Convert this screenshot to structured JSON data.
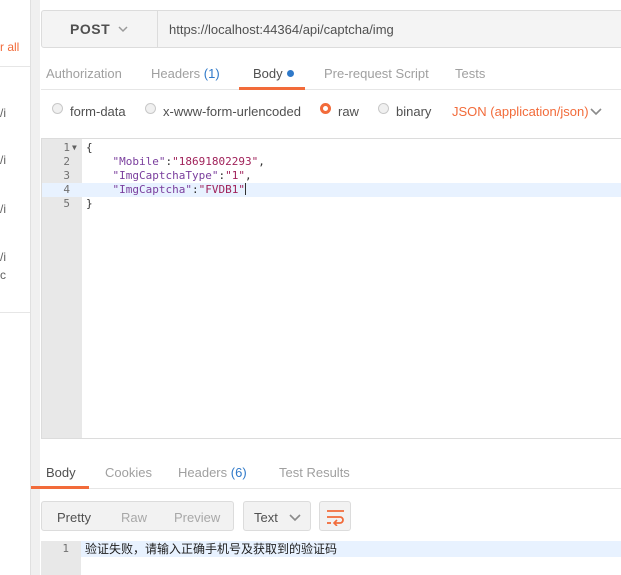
{
  "sidebar": {
    "clear_all": "r all",
    "fragments": [
      "/i",
      "/i",
      "/i",
      "/i",
      "c"
    ]
  },
  "request": {
    "method": "POST",
    "url": "https://localhost:44364/api/captcha/img"
  },
  "tabs": {
    "authorization": "Authorization",
    "headers": "Headers",
    "headers_count": "(1)",
    "body": "Body",
    "prerequest": "Pre-request Script",
    "tests": "Tests"
  },
  "body_types": {
    "form_data": "form-data",
    "urlencoded": "x-www-form-urlencoded",
    "raw": "raw",
    "binary": "binary",
    "selected": "raw",
    "content_type": "JSON (application/json)"
  },
  "editor": {
    "lines": [
      {
        "num": "1",
        "text": "{"
      },
      {
        "num": "2",
        "key": "\"Mobile\"",
        "value": "\"18691802293\"",
        "tail": ","
      },
      {
        "num": "3",
        "key": "\"ImgCaptchaType\"",
        "value": "\"1\"",
        "tail": ","
      },
      {
        "num": "4",
        "key": "\"ImgCaptcha\"",
        "value": "\"FVDB1\"",
        "tail": ""
      },
      {
        "num": "5",
        "text": "}"
      }
    ]
  },
  "response": {
    "tabs": {
      "body": "Body",
      "cookies": "Cookies",
      "headers": "Headers",
      "headers_count": "(6)",
      "test_results": "Test Results"
    },
    "views": {
      "pretty": "Pretty",
      "raw": "Raw",
      "preview": "Preview"
    },
    "format": "Text",
    "line_num": "1",
    "text": "验证失败，请输入正确手机号及获取到的验证码"
  },
  "colors": {
    "accent": "#f26b3a",
    "link": "#2f79c9"
  }
}
